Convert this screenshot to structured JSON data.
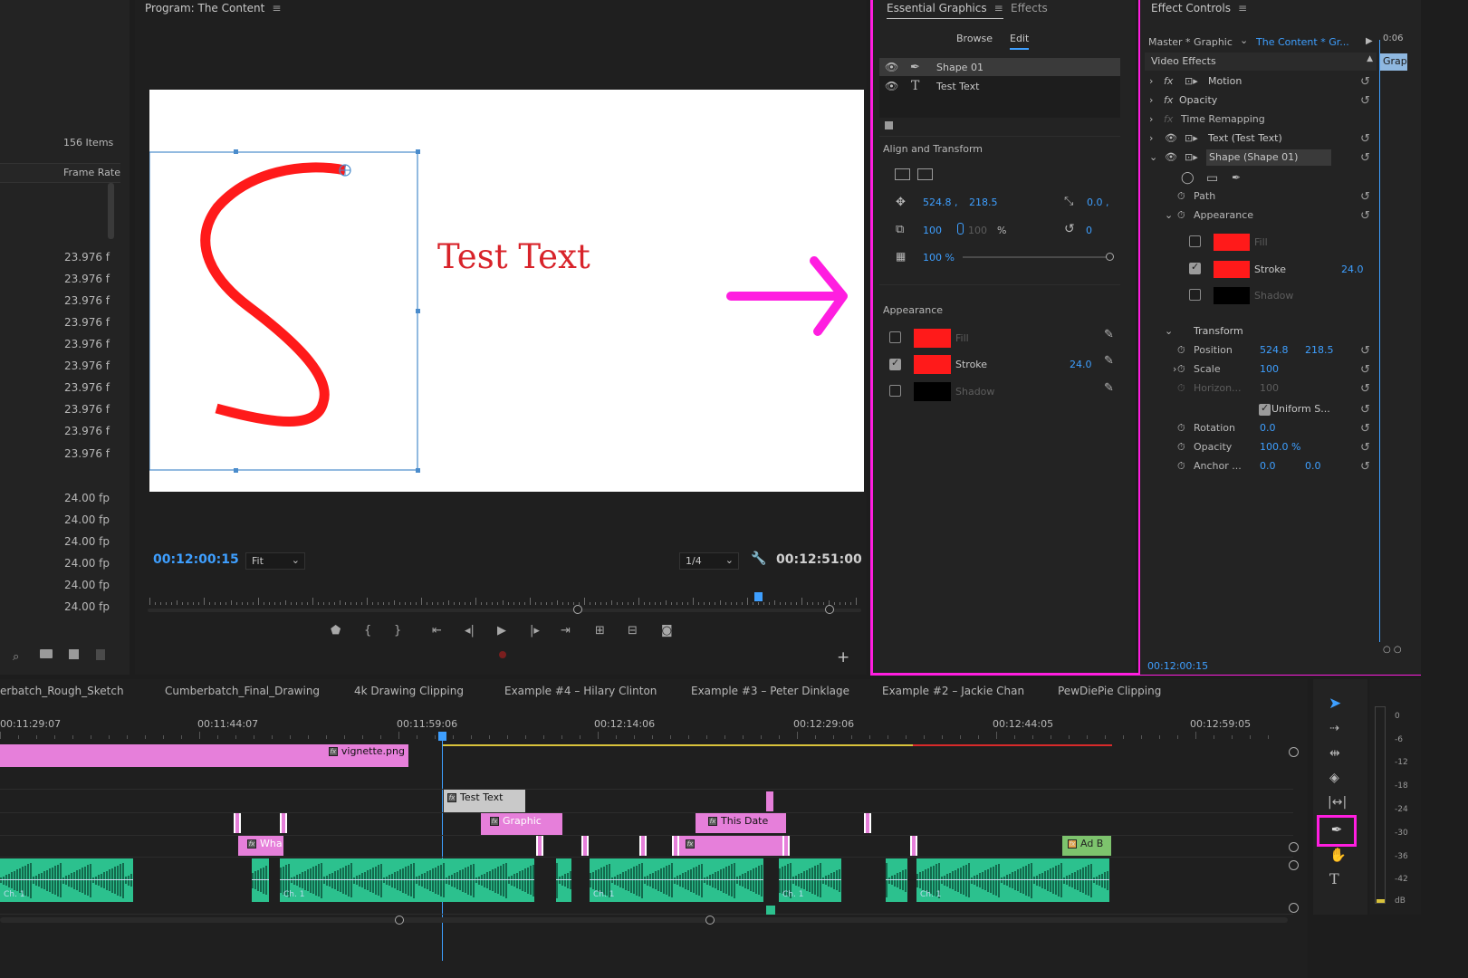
{
  "project": {
    "item_count": "156 Items",
    "col_header": "Frame Rate",
    "rates": [
      "23.976 f",
      "23.976 f",
      "23.976 f",
      "23.976 f",
      "23.976 f",
      "23.976 f",
      "23.976 f",
      "23.976 f",
      "23.976 f",
      "23.976 f",
      "24.00 fp",
      "24.00 fp",
      "24.00 fp",
      "24.00 fp",
      "24.00 fp",
      "24.00 fp"
    ]
  },
  "program": {
    "title": "Program: The Content",
    "timecode": "00:12:00:15",
    "fit": "Fit",
    "resolution": "1/4",
    "duration": "00:12:51:00",
    "canvas_text": "Test Text"
  },
  "essential": {
    "tab_active": "Essential Graphics",
    "tab_other": "Effects",
    "browse": "Browse",
    "edit": "Edit",
    "layers": [
      {
        "name": "Shape 01"
      },
      {
        "name": "Test Text"
      }
    ],
    "align_title": "Align and Transform",
    "pos_x": "524.8 ,",
    "pos_y": "218.5",
    "anchor": "0.0 ,",
    "scale": "100",
    "scale_h": "100",
    "pct": "%",
    "rotation": "0",
    "opacity": "100 %",
    "appearance_title": "Appearance",
    "fill": "Fill",
    "stroke": "Stroke",
    "stroke_width": "24.0",
    "shadow": "Shadow",
    "colors": {
      "fill": "#ff1a1a",
      "stroke": "#ff1a1a",
      "shadow": "#000000"
    }
  },
  "effect_controls": {
    "title": "Effect Controls",
    "master": "Master * Graphic",
    "clip": "The Content * Gr...",
    "mini_tc": "0:06",
    "mini_clip": "Grap",
    "video_effects": "Video Effects",
    "motion": "Motion",
    "opacity": "Opacity",
    "time_remap": "Time Remapping",
    "text_layer": "Text (Test Text)",
    "shape_layer": "Shape (Shape 01)",
    "path": "Path",
    "appearance": "Appearance",
    "fill": "Fill",
    "stroke": "Stroke",
    "stroke_width": "24.0",
    "shadow": "Shadow",
    "transform": "Transform",
    "position": "Position",
    "pos_x": "524.8",
    "pos_y": "218.5",
    "scale": "Scale",
    "scale_v": "100",
    "horizontal": "Horizon...",
    "horizontal_v": "100",
    "uniform": "Uniform S...",
    "rotation": "Rotation",
    "rotation_v": "0.0",
    "opacity_lbl": "Opacity",
    "opacity_v": "100.0 %",
    "anchor": "Anchor ...",
    "anchor_x": "0.0",
    "anchor_y": "0.0",
    "footer_tc": "00:12:00:15"
  },
  "timeline": {
    "tabs": [
      "erbatch_Rough_Sketch",
      "Cumberbatch_Final_Drawing",
      "4k Drawing Clipping",
      "Example #4 – Hilary Clinton",
      "Example #3 – Peter Dinklage",
      "Example #2 – Jackie Chan",
      "PewDiePie Clipping"
    ],
    "ruler": [
      "00:11:29:07",
      "00:11:44:07",
      "00:11:59:06",
      "00:12:14:06",
      "00:12:29:06",
      "00:12:44:05",
      "00:12:59:05"
    ],
    "clips": {
      "vignette": "vignette.png",
      "test_text": "Test Text",
      "graphic": "Graphic",
      "this_date": "This Date",
      "wha": "Wha",
      "ad": "Ad B",
      "ch": "Ch. 1"
    }
  },
  "meter": {
    "labels": [
      "0",
      "-6",
      "-12",
      "-18",
      "-24",
      "-30",
      "-36",
      "-42",
      "dB"
    ]
  },
  "annotation_color": "#ff1ee0"
}
